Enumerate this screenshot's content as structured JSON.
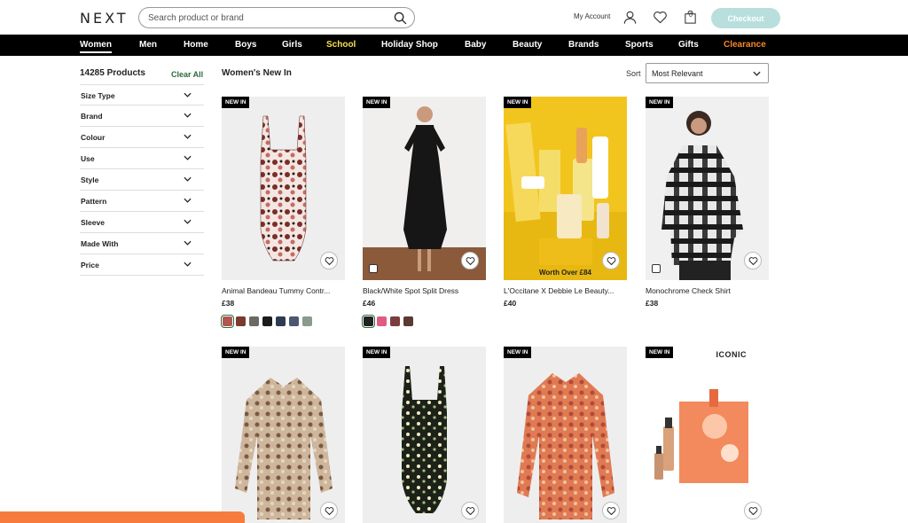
{
  "header": {
    "logo": "NEXT",
    "search_placeholder": "Search product or brand",
    "account_label": "My Account",
    "bag_count": "0",
    "checkout_label": "Checkout"
  },
  "nav": {
    "items": [
      {
        "label": "Women",
        "color": "#ffffff",
        "active": true
      },
      {
        "label": "Men",
        "color": "#ffffff"
      },
      {
        "label": "Home",
        "color": "#ffffff"
      },
      {
        "label": "Boys",
        "color": "#ffffff"
      },
      {
        "label": "Girls",
        "color": "#ffffff"
      },
      {
        "label": "School",
        "color": "#f6e04a"
      },
      {
        "label": "Holiday Shop",
        "color": "#ffffff"
      },
      {
        "label": "Baby",
        "color": "#ffffff"
      },
      {
        "label": "Beauty",
        "color": "#ffffff"
      },
      {
        "label": "Brands",
        "color": "#ffffff"
      },
      {
        "label": "Sports",
        "color": "#ffffff"
      },
      {
        "label": "Gifts",
        "color": "#ffffff"
      },
      {
        "label": "Clearance",
        "color": "#f5862a"
      }
    ]
  },
  "sidebar": {
    "product_count": "14285 Products",
    "clear_all": "Clear All",
    "filters": [
      "Size Type",
      "Brand",
      "Colour",
      "Use",
      "Style",
      "Pattern",
      "Sleeve",
      "Made With",
      "Price"
    ]
  },
  "content": {
    "title": "Women's New In",
    "sort_label": "Sort",
    "sort_value": "Most Relevant"
  },
  "products": [
    {
      "badge": "NEW IN",
      "name": "Animal Bandeau Tummy Contr...",
      "price": "£38",
      "swatches": [
        "#b2574f",
        "#7a3b2e",
        "#6d6a63",
        "#1c1c1c",
        "#2d3c52",
        "#4b5870",
        "#8a9a8e"
      ]
    },
    {
      "badge": "NEW IN",
      "name": "Black/White Spot Split Dress",
      "price": "£46",
      "swatches": [
        "#222222",
        "#e05a82",
        "#7a3e3e",
        "#5a3a32"
      ]
    },
    {
      "badge": "NEW IN",
      "name": "L'Occitane X Debbie Le Beauty...",
      "price": "£40",
      "promo": "Worth Over £84"
    },
    {
      "badge": "NEW IN",
      "name": "Monochrome Check Shirt",
      "price": "£38"
    },
    {
      "badge": "NEW IN"
    },
    {
      "badge": "NEW IN"
    },
    {
      "badge": "NEW IN"
    },
    {
      "badge": "NEW IN",
      "brand": "ICONIC"
    }
  ],
  "colors": {
    "accent_green": "#2a6b3c",
    "checkout_bg": "#b8dfdd",
    "nav_bg": "#000000",
    "bottom_bar": "#f57c3c"
  }
}
